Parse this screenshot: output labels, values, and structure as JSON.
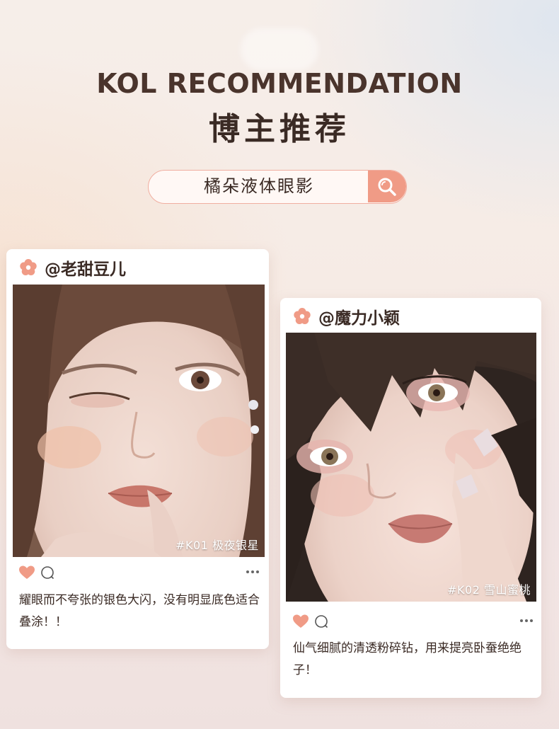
{
  "header": {
    "title_en": "KOL RECOMMENDATION",
    "title_cn": "博主推荐"
  },
  "search": {
    "value": "橘朵液体眼影",
    "icon": "search-icon"
  },
  "colors": {
    "accent": "#f09b86",
    "title": "#4a342c",
    "text": "#3a2a24"
  },
  "posts": [
    {
      "username": "@老甜豆儿",
      "shade": "#K01 极夜银星",
      "caption": "耀眼而不夸张的银色大闪，没有明显底色适合叠涂！！",
      "icons": [
        "flower-icon",
        "heart-icon",
        "comment-icon",
        "more-icon"
      ]
    },
    {
      "username": "@魔力小颖",
      "shade": "#K02 雪山蜜桃",
      "caption": "仙气细腻的清透粉碎钻，用来提亮卧蚕绝绝子！",
      "icons": [
        "flower-icon",
        "heart-icon",
        "comment-icon",
        "more-icon"
      ]
    }
  ]
}
